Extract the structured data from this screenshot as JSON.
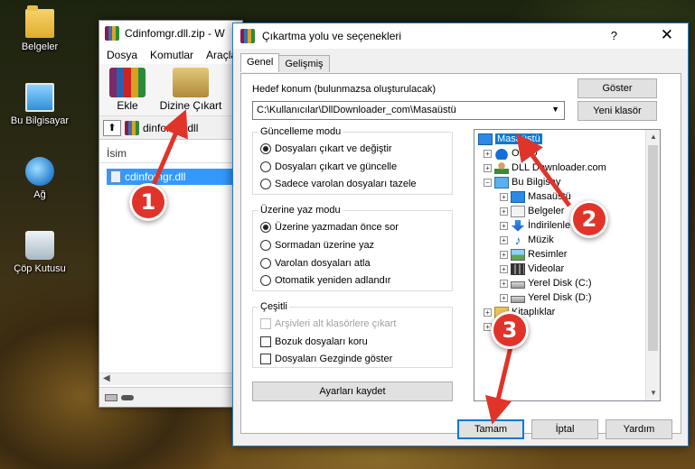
{
  "desktop": {
    "icons": [
      {
        "label": "Belgeler"
      },
      {
        "label": "Bu Bilgisayar"
      },
      {
        "label": "Ağ"
      },
      {
        "label": "Çöp Kutusu"
      }
    ]
  },
  "winrar": {
    "title": "Cdinfomgr.dll.zip - W",
    "menu": [
      "Dosya",
      "Komutlar",
      "Araçla"
    ],
    "toolbar": {
      "add_label": "Ekle",
      "extract_label": "Dizine Çıkart"
    },
    "path_text": "dinfomgr.dll",
    "list_header": "İsim",
    "selected_file": "cdinfomgr.dll"
  },
  "dialog": {
    "title": "Çıkartma yolu ve seçenekleri",
    "help": "?",
    "close": "✕",
    "tabs": [
      "Genel",
      "Gelişmiş"
    ],
    "dest_label": "Hedef konum (bulunmazsa oluşturulacak)",
    "dest_value": "C:\\Kullanıcılar\\DllDownloader_com\\Masaüstü",
    "show_button": "Göster",
    "new_folder_button": "Yeni klasör",
    "update_mode": {
      "title": "Güncelleme modu",
      "options": [
        "Dosyaları çıkart ve değiştir",
        "Dosyaları çıkart ve güncelle",
        "Sadece varolan dosyaları tazele"
      ],
      "selected": 0
    },
    "overwrite_mode": {
      "title": "Üzerine yaz modu",
      "options": [
        "Üzerine yazmadan önce sor",
        "Sormadan üzerine yaz",
        "Varolan dosyaları atla",
        "Otomatik yeniden adlandır"
      ],
      "selected": 0
    },
    "misc": {
      "title": "Çeşitli",
      "options": [
        "Arşivleri alt klasörlere çıkart",
        "Bozuk dosyaları koru",
        "Dosyaları Gezginde göster"
      ],
      "disabled": [
        true,
        false,
        false
      ]
    },
    "save_settings": "Ayarları kaydet",
    "tree": [
      {
        "label": "Masaüstü",
        "icon": "desktop-icon",
        "level": 0,
        "selected": true
      },
      {
        "label": "OneD",
        "icon": "cloud-icon",
        "level": 1,
        "expander": "+"
      },
      {
        "label": "DLL Downloader.com",
        "icon": "user-icon",
        "level": 1,
        "expander": "+"
      },
      {
        "label": "Bu Bilgisay",
        "icon": "pc-icon",
        "level": 1,
        "expander": "−"
      },
      {
        "label": "Masaüstü",
        "icon": "desktop-icon",
        "level": 2,
        "expander": "+"
      },
      {
        "label": "Belgeler",
        "icon": "document-icon",
        "level": 2,
        "expander": "+"
      },
      {
        "label": "İndirilenle",
        "icon": "download-icon",
        "level": 2,
        "expander": "+"
      },
      {
        "label": "Müzik",
        "icon": "music-icon",
        "level": 2,
        "expander": "+"
      },
      {
        "label": "Resimler",
        "icon": "picture-icon",
        "level": 2,
        "expander": "+"
      },
      {
        "label": "Videolar",
        "icon": "video-icon",
        "level": 2,
        "expander": "+"
      },
      {
        "label": "Yerel Disk (C:)",
        "icon": "drive-icon",
        "level": 2,
        "expander": "+"
      },
      {
        "label": "Yerel Disk (D:)",
        "icon": "drive-icon",
        "level": 2,
        "expander": "+"
      },
      {
        "label": "Kitaplıklar",
        "icon": "library-icon",
        "level": 1,
        "expander": "+"
      },
      {
        "label": "",
        "icon": "folder-icon",
        "level": 1,
        "expander": "+"
      }
    ],
    "ok_button": "Tamam",
    "cancel_button": "İptal",
    "help_button": "Yardım"
  },
  "annotations": [
    "1",
    "2",
    "3"
  ],
  "colors": {
    "accent": "#0078d7",
    "badge": "#e0342a",
    "selection": "#3399ff"
  }
}
